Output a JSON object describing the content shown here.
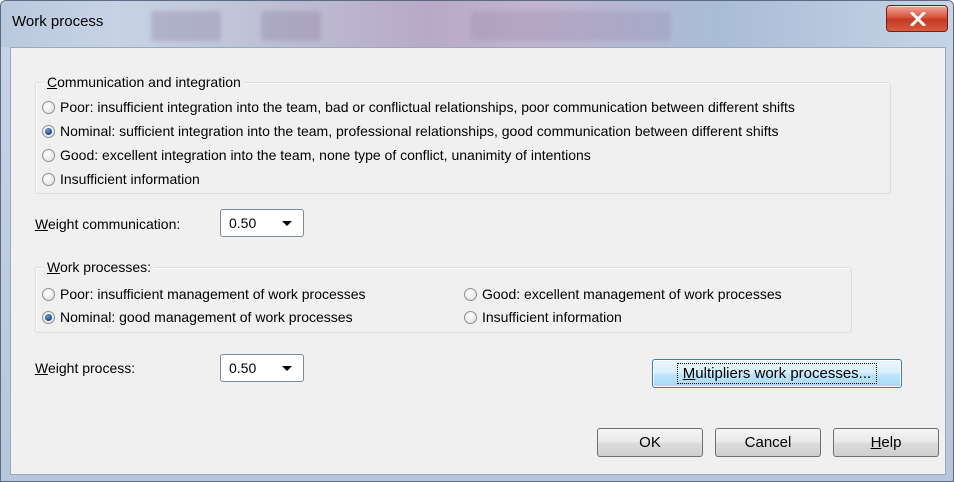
{
  "window": {
    "title": "Work process"
  },
  "communication": {
    "legend_hotkey": "C",
    "legend_rest": "ommunication and integration",
    "options": [
      {
        "label": "Poor: insufficient integration into the team, bad or conflictual relationships, poor communication between different shifts",
        "checked": false
      },
      {
        "label": "Nominal: sufficient integration into the team, professional relationships, good communication between different shifts",
        "checked": true
      },
      {
        "label": "Good: excellent integration into the team, none type of conflict, unanimity of intentions",
        "checked": false
      },
      {
        "label": "Insufficient information",
        "checked": false
      }
    ]
  },
  "weight_communication": {
    "label_hotkey": "W",
    "label_rest": "eight communication:",
    "value": "0.50"
  },
  "work_processes": {
    "legend_hotkey": "W",
    "legend_rest": "ork processes:",
    "options": [
      {
        "label": "Poor: insufficient management of work processes",
        "checked": false
      },
      {
        "label": "Nominal: good management of work processes",
        "checked": true
      },
      {
        "label": "Good: excellent management of work processes",
        "checked": false
      },
      {
        "label": "Insufficient information",
        "checked": false
      }
    ]
  },
  "weight_process": {
    "label_hotkey": "W",
    "label_rest": "eight process:",
    "value": "0.50"
  },
  "buttons": {
    "multipliers_hotkey": "M",
    "multipliers_rest": "ultipliers work processes...",
    "ok": "OK",
    "cancel": "Cancel",
    "help_hotkey": "H",
    "help_rest": "elp"
  },
  "icons": {
    "close": "close-x-icon",
    "radio": "radio-button"
  },
  "colors": {
    "close_button": "#c23a22",
    "focus_button": "#3c7fb1",
    "dialog_bg": "#f0f0f0"
  }
}
